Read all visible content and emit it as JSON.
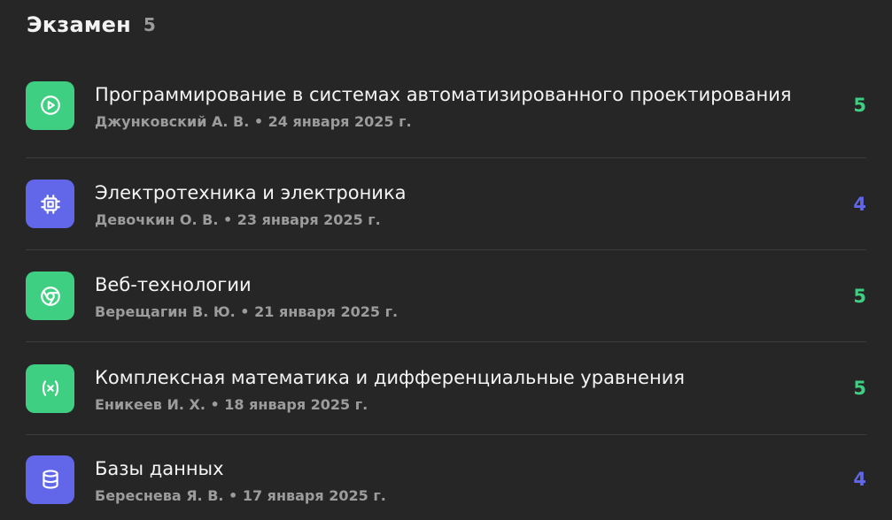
{
  "section": {
    "title": "Экзамен",
    "count": "5"
  },
  "colors": {
    "background": "#262626",
    "green": "#3ecf82",
    "blue": "#6167e8",
    "divider": "#3d3d3d",
    "meta_text": "#9c9c9c"
  },
  "exams": [
    {
      "title": "Программирование в системах автоматизированного проектирования",
      "meta": "Джунковский А. В. • 24 января 2025 г.",
      "grade": "5",
      "icon": "play-circle-icon",
      "color": "green"
    },
    {
      "title": "Электротехника и электроника",
      "meta": "Девочкин О. В. • 23 января 2025 г.",
      "grade": "4",
      "icon": "chip-icon",
      "color": "blue"
    },
    {
      "title": "Веб-технологии",
      "meta": "Верещагин В. Ю. • 21 января 2025 г.",
      "grade": "5",
      "icon": "chrome-icon",
      "color": "green"
    },
    {
      "title": "Комплексная математика и дифференциальные уравнения",
      "meta": "Еникеев И. Х. • 18 января 2025 г.",
      "grade": "5",
      "icon": "variable-icon",
      "color": "green"
    },
    {
      "title": "Базы данных",
      "meta": "Береснева Я. В. • 17 января 2025 г.",
      "grade": "4",
      "icon": "database-icon",
      "color": "blue"
    }
  ]
}
